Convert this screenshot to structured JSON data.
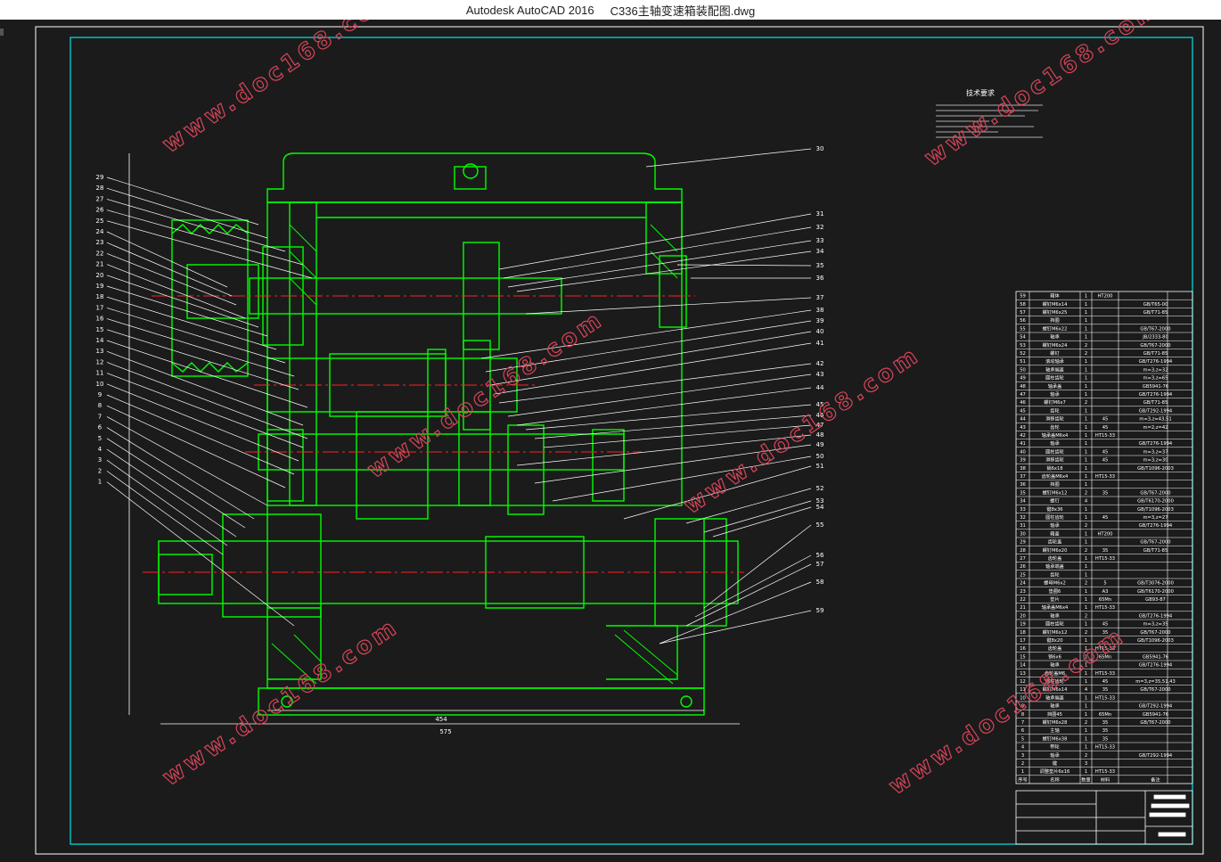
{
  "window": {
    "app_title": "Autodesk AutoCAD 2016",
    "file_name": "C336主轴变速箱装配图.dwg"
  },
  "colors": {
    "background": "#1b1b1b",
    "frame": "#00e5e5",
    "geometry": "#00ff00",
    "leader": "#ffffff",
    "center_line": "#ff2020",
    "watermark": "#d7455a"
  },
  "watermark_text": "www.doc168.com",
  "drawing": {
    "technical_requirements_title": "技术要求",
    "balloons_left": [
      "29",
      "28",
      "27",
      "26",
      "25",
      "24",
      "23",
      "22",
      "21",
      "20",
      "19",
      "18",
      "17",
      "16",
      "15",
      "14",
      "13",
      "12",
      "11",
      "10",
      "9",
      "8",
      "7",
      "6",
      "5",
      "4",
      "3",
      "2",
      "1"
    ],
    "balloons_right": [
      "30",
      "31",
      "32",
      "33",
      "34",
      "35",
      "36",
      "37",
      "38",
      "39",
      "40",
      "41",
      "42",
      "43",
      "44",
      "45",
      "46",
      "47",
      "48",
      "49",
      "50",
      "51",
      "52",
      "53",
      "54",
      "55",
      "56",
      "57",
      "58",
      "59"
    ],
    "dimensions": [
      "575",
      "454"
    ]
  },
  "bom": {
    "rows": [
      {
        "no": "59",
        "name": "箱体",
        "qty": "1",
        "mat": "HT200",
        "std": ""
      },
      {
        "no": "58",
        "name": "螺钉M6x14",
        "qty": "1",
        "mat": "",
        "std": "GB/T65-00"
      },
      {
        "no": "57",
        "name": "螺钉M6x25",
        "qty": "1",
        "mat": "",
        "std": "GB/T71-85"
      },
      {
        "no": "56",
        "name": "挡圈",
        "qty": "1",
        "mat": "",
        "std": ""
      },
      {
        "no": "55",
        "name": "螺钉M6x22",
        "qty": "1",
        "mat": "",
        "std": "GB/T67-2000"
      },
      {
        "no": "54",
        "name": "轴承",
        "qty": "1",
        "mat": "",
        "std": "JB/2333-80"
      },
      {
        "no": "53",
        "name": "螺钉M6x24",
        "qty": "2",
        "mat": "",
        "std": "GB/T67-2000"
      },
      {
        "no": "52",
        "name": "螺钉",
        "qty": "2",
        "mat": "",
        "std": "GB/T71-85"
      },
      {
        "no": "51",
        "name": "滚动轴承",
        "qty": "1",
        "mat": "",
        "std": "GB/T276-1994"
      },
      {
        "no": "50",
        "name": "轴承端盖",
        "qty": "1",
        "mat": "",
        "std": "m=3,z=32"
      },
      {
        "no": "49",
        "name": "圆柱齿轮",
        "qty": "1",
        "mat": "",
        "std": "m=3,z=65"
      },
      {
        "no": "48",
        "name": "轴承盖",
        "qty": "1",
        "mat": "",
        "std": "GB5941-76"
      },
      {
        "no": "47",
        "name": "轴承",
        "qty": "1",
        "mat": "",
        "std": "GB/T276-1994"
      },
      {
        "no": "46",
        "name": "螺钉M6x7",
        "qty": "2",
        "mat": "",
        "std": "GB/T71-85"
      },
      {
        "no": "45",
        "name": "齿轮",
        "qty": "1",
        "mat": "",
        "std": "GB/T292-1994"
      },
      {
        "no": "44",
        "name": "滑移齿轮",
        "qty": "1",
        "mat": "45",
        "std": "m=3,z=43,51"
      },
      {
        "no": "43",
        "name": "齿轮",
        "qty": "1",
        "mat": "45",
        "std": "m=2,z=42"
      },
      {
        "no": "42",
        "name": "轴承盖M6x4",
        "qty": "1",
        "mat": "HT15-33",
        "std": ""
      },
      {
        "no": "41",
        "name": "轴承",
        "qty": "1",
        "mat": "",
        "std": "GB/T276-1994"
      },
      {
        "no": "40",
        "name": "圆柱齿轮",
        "qty": "1",
        "mat": "45",
        "std": "m=3,z=37"
      },
      {
        "no": "39",
        "name": "滑移齿轮",
        "qty": "1",
        "mat": "45",
        "std": "m=3,z=30"
      },
      {
        "no": "38",
        "name": "销6x18",
        "qty": "1",
        "mat": "",
        "std": "GB/T1096-2003"
      },
      {
        "no": "37",
        "name": "齿轮盖M6x4",
        "qty": "1",
        "mat": "HT15-33",
        "std": ""
      },
      {
        "no": "36",
        "name": "挡圈",
        "qty": "1",
        "mat": "",
        "std": ""
      },
      {
        "no": "35",
        "name": "螺钉M6x12",
        "qty": "2",
        "mat": "35",
        "std": "GB/T67-2000"
      },
      {
        "no": "34",
        "name": "螺钉",
        "qty": "4",
        "mat": "",
        "std": "GB/T6170-2000"
      },
      {
        "no": "33",
        "name": "键8x36",
        "qty": "1",
        "mat": "",
        "std": "GB/T1096-2003"
      },
      {
        "no": "32",
        "name": "圆柱齿轮",
        "qty": "1",
        "mat": "45",
        "std": "m=3,z=27"
      },
      {
        "no": "31",
        "name": "轴承",
        "qty": "2",
        "mat": "",
        "std": "GB/T276-1994"
      },
      {
        "no": "30",
        "name": "箱盖",
        "qty": "1",
        "mat": "HT200",
        "std": ""
      },
      {
        "no": "29",
        "name": "齿轮盖",
        "qty": "1",
        "mat": "",
        "std": "GB/T67-2000"
      },
      {
        "no": "28",
        "name": "螺钉M6x20",
        "qty": "2",
        "mat": "35",
        "std": "GB/T71-85"
      },
      {
        "no": "27",
        "name": "齿轮盖",
        "qty": "1",
        "mat": "HT15-33",
        "std": ""
      },
      {
        "no": "26",
        "name": "轴承端盖",
        "qty": "1",
        "mat": "",
        "std": ""
      },
      {
        "no": "25",
        "name": "齿轮",
        "qty": "1",
        "mat": "",
        "std": ""
      },
      {
        "no": "24",
        "name": "螺母M6x2",
        "qty": "2",
        "mat": "5",
        "std": "GB/T3076-2000"
      },
      {
        "no": "23",
        "name": "垫圈6",
        "qty": "1",
        "mat": "A3",
        "std": "GB/T6170-2000"
      },
      {
        "no": "22",
        "name": "垫片",
        "qty": "1",
        "mat": "65Mn",
        "std": "GB93-87"
      },
      {
        "no": "21",
        "name": "轴承盖M6x4",
        "qty": "1",
        "mat": "HT15-33",
        "std": ""
      },
      {
        "no": "20",
        "name": "轴承",
        "qty": "2",
        "mat": "",
        "std": "GB/T276-1994"
      },
      {
        "no": "19",
        "name": "圆柱齿轮",
        "qty": "1",
        "mat": "45",
        "std": "m=3,z=35"
      },
      {
        "no": "18",
        "name": "螺钉M6x12",
        "qty": "2",
        "mat": "35",
        "std": "GB/T67-2000"
      },
      {
        "no": "17",
        "name": "键8x20",
        "qty": "1",
        "mat": "",
        "std": "GB/T1096-2003"
      },
      {
        "no": "16",
        "name": "齿轮盖",
        "qty": "1",
        "mat": "HT15-33",
        "std": ""
      },
      {
        "no": "15",
        "name": "销6x6",
        "qty": "1",
        "mat": "65Mn",
        "std": "GB5941-76"
      },
      {
        "no": "14",
        "name": "轴承",
        "qty": "1",
        "mat": "",
        "std": "GB/T276-1994"
      },
      {
        "no": "13",
        "name": "齿轮盖M6",
        "qty": "1",
        "mat": "HT15-33",
        "std": ""
      },
      {
        "no": "12",
        "name": "圆柱齿轮",
        "qty": "1",
        "mat": "45",
        "std": "m=3,z=35,51,43"
      },
      {
        "no": "11",
        "name": "螺钉M6x14",
        "qty": "4",
        "mat": "35",
        "std": "GB/T67-2000"
      },
      {
        "no": "10",
        "name": "轴承端盖",
        "qty": "1",
        "mat": "HT15-33",
        "std": ""
      },
      {
        "no": "9",
        "name": "轴承",
        "qty": "1",
        "mat": "",
        "std": "GB/T292-1994"
      },
      {
        "no": "8",
        "name": "挡圈45",
        "qty": "1",
        "mat": "65Mn",
        "std": "GB5941-76"
      },
      {
        "no": "7",
        "name": "螺钉M6x28",
        "qty": "2",
        "mat": "35",
        "std": "GB/T67-2000"
      },
      {
        "no": "6",
        "name": "主轴",
        "qty": "1",
        "mat": "35",
        "std": ""
      },
      {
        "no": "5",
        "name": "螺钉M6x38",
        "qty": "1",
        "mat": "35",
        "std": ""
      },
      {
        "no": "4",
        "name": "带轮",
        "qty": "1",
        "mat": "HT15-33",
        "std": ""
      },
      {
        "no": "3",
        "name": "轴承",
        "qty": "2",
        "mat": "",
        "std": "GB/T292-1994"
      },
      {
        "no": "2",
        "name": "键",
        "qty": "3",
        "mat": "",
        "std": ""
      },
      {
        "no": "1",
        "name": "调整垫片6x16",
        "qty": "1",
        "mat": "HT15-33",
        "std": ""
      }
    ],
    "header": {
      "no": "序号",
      "name": "名称",
      "qty": "数量",
      "mat": "材料",
      "std": "备注"
    }
  }
}
